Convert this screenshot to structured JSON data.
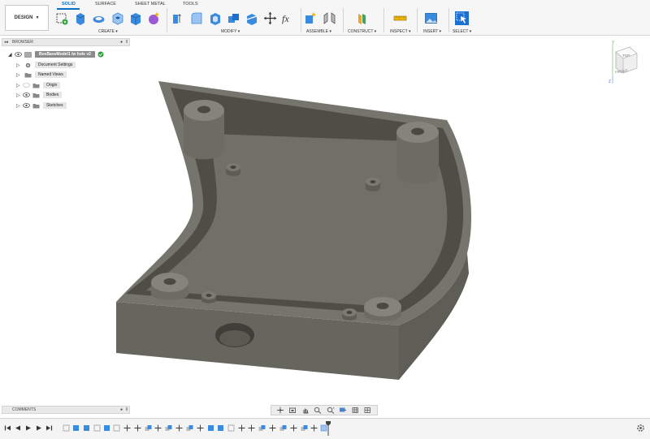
{
  "toolbar": {
    "workspace_label": "DESIGN",
    "tabs": [
      {
        "label": "SOLID",
        "active": true
      },
      {
        "label": "SURFACE",
        "active": false
      },
      {
        "label": "SHEET METAL",
        "active": false
      },
      {
        "label": "TOOLS",
        "active": false
      }
    ],
    "groups": {
      "create": "CREATE ▾",
      "modify": "MODIFY ▾",
      "assemble": "ASSEMBLE ▾",
      "construct": "CONSTRUCT ▾",
      "inspect": "INSPECT ▾",
      "insert": "INSERT ▾",
      "select": "SELECT ▾"
    },
    "accent_color": "#0a6fc2"
  },
  "browser": {
    "title": "BROWSER",
    "root": "BoxBaseModel1 /w hole v2",
    "items": [
      {
        "label": "Document Settings",
        "icon": "gear-icon"
      },
      {
        "label": "Named Views",
        "icon": "folder-icon"
      },
      {
        "label": "Origin",
        "icon": "folder-icon"
      },
      {
        "label": "Bodies",
        "icon": "folder-icon"
      },
      {
        "label": "Sketches",
        "icon": "folder-icon"
      }
    ]
  },
  "viewcube": {
    "top": "TOP",
    "front": "FRONT",
    "y": "Y",
    "z": "Z"
  },
  "comments": {
    "title": "COMMENTS"
  }
}
